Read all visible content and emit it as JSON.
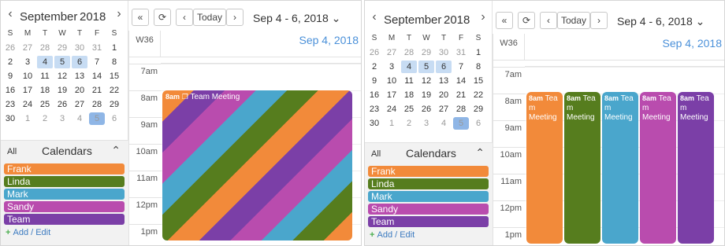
{
  "mini_calendar": {
    "month": "September",
    "year": "2018",
    "weekday_headers": [
      "S",
      "M",
      "T",
      "W",
      "T",
      "F",
      "S"
    ],
    "weeks": [
      [
        {
          "d": "26",
          "o": true
        },
        {
          "d": "27",
          "o": true
        },
        {
          "d": "28",
          "o": true
        },
        {
          "d": "29",
          "o": true
        },
        {
          "d": "30",
          "o": true
        },
        {
          "d": "31",
          "o": true
        },
        {
          "d": "1"
        }
      ],
      [
        {
          "d": "2"
        },
        {
          "d": "3"
        },
        {
          "d": "4",
          "s": true
        },
        {
          "d": "5",
          "s": true
        },
        {
          "d": "6",
          "s": true
        },
        {
          "d": "7"
        },
        {
          "d": "8"
        }
      ],
      [
        {
          "d": "9"
        },
        {
          "d": "10"
        },
        {
          "d": "11"
        },
        {
          "d": "12"
        },
        {
          "d": "13"
        },
        {
          "d": "14"
        },
        {
          "d": "15"
        }
      ],
      [
        {
          "d": "16"
        },
        {
          "d": "17"
        },
        {
          "d": "18"
        },
        {
          "d": "19"
        },
        {
          "d": "20"
        },
        {
          "d": "21"
        },
        {
          "d": "22"
        }
      ],
      [
        {
          "d": "23"
        },
        {
          "d": "24"
        },
        {
          "d": "25"
        },
        {
          "d": "26"
        },
        {
          "d": "27"
        },
        {
          "d": "28"
        },
        {
          "d": "29"
        }
      ],
      [
        {
          "d": "30"
        },
        {
          "d": "1",
          "o": true
        },
        {
          "d": "2",
          "o": true
        },
        {
          "d": "3",
          "o": true
        },
        {
          "d": "4",
          "o": true
        },
        {
          "d": "5",
          "o": true,
          "t": true
        },
        {
          "d": "6",
          "o": true
        }
      ]
    ]
  },
  "calendars_panel": {
    "all_label": "All",
    "title": "Calendars",
    "items": [
      {
        "name": "Frank",
        "color": "#f28a3a"
      },
      {
        "name": "Linda",
        "color": "#567d1e"
      },
      {
        "name": "Mark",
        "color": "#4aa6cc"
      },
      {
        "name": "Sandy",
        "color": "#b94cae"
      },
      {
        "name": "Team",
        "color": "#7b3fa7"
      }
    ],
    "add_edit_label": "Add / Edit"
  },
  "toolbar": {
    "today_label": "Today",
    "range_label": "Sep 4 - 6, 2018",
    "prev_range_icon": "double-chevron-left-icon",
    "refresh_icon": "refresh-icon"
  },
  "day_view": {
    "week_label": "W36",
    "date_label": "Sep 4, 2018",
    "hours": [
      "7am",
      "8am",
      "9am",
      "10am",
      "11am",
      "12pm",
      "1pm"
    ]
  },
  "event": {
    "time": "8am",
    "title": "Team Meeting",
    "split_title_lines": [
      "Tea",
      "m",
      "Meeting"
    ]
  }
}
